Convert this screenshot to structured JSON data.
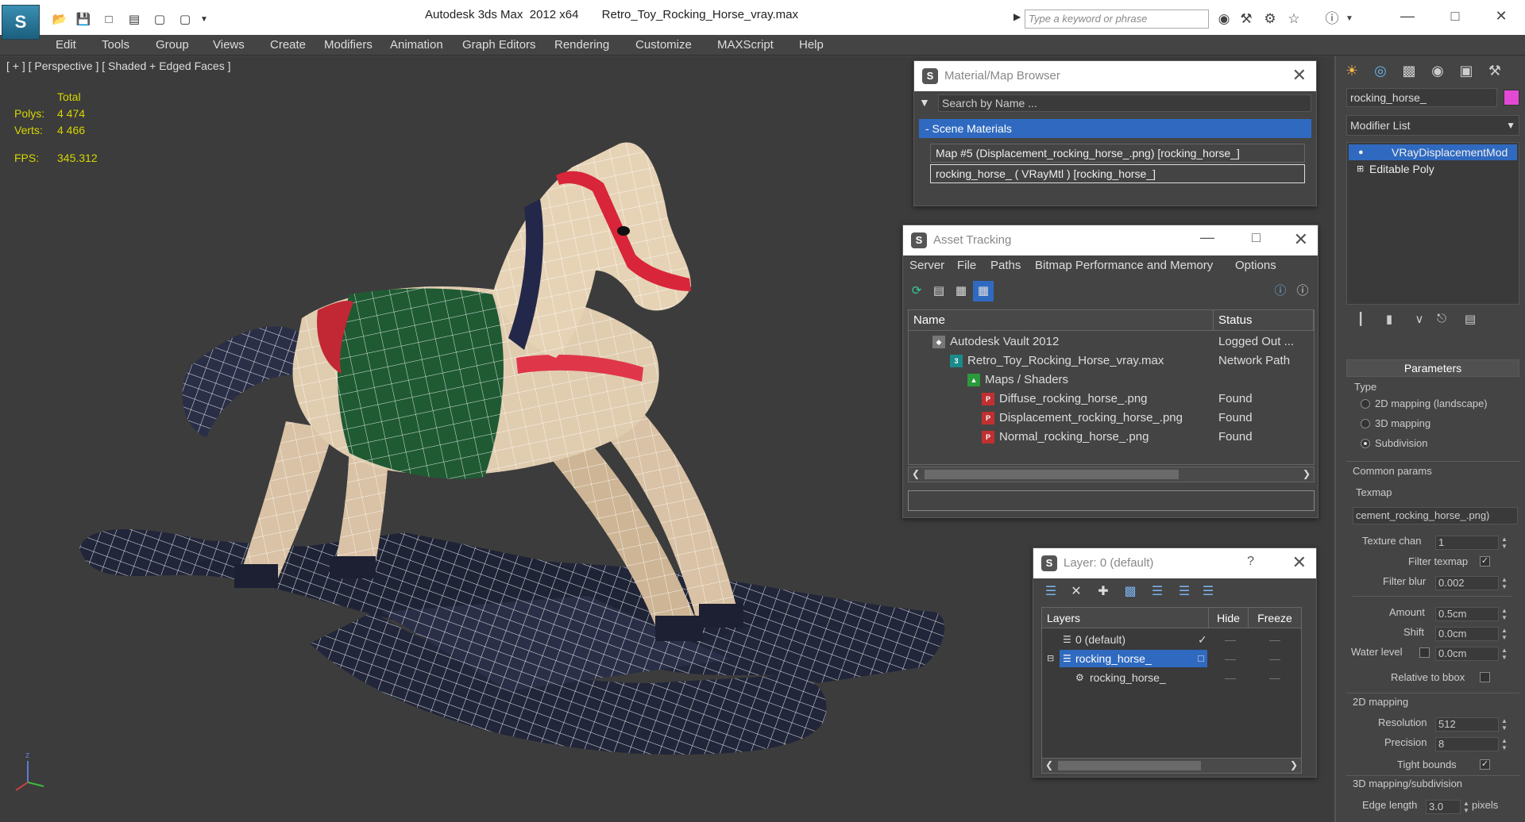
{
  "titlebar": {
    "app_title": "Autodesk 3ds Max  2012 x64",
    "file_name": "Retro_Toy_Rocking_Horse_vray.max",
    "search_placeholder": "Type a keyword or phrase"
  },
  "menu": [
    "Edit",
    "Tools",
    "Group",
    "Views",
    "Create",
    "Modifiers",
    "Animation",
    "Graph Editors",
    "Rendering",
    "Customize",
    "MAXScript",
    "Help"
  ],
  "viewport": {
    "label": "[ + ] [ Perspective ] [ Shaded + Edged Faces ]",
    "stats": {
      "total_label": "Total",
      "polys_label": "Polys:",
      "polys_value": "4 474",
      "verts_label": "Verts:",
      "verts_value": "4 466",
      "fps_label": "FPS:",
      "fps_value": "345.312"
    },
    "axis": {
      "z": "z"
    }
  },
  "material_browser": {
    "title": "Material/Map Browser",
    "search_placeholder": "Search by Name ...",
    "group_label": "- Scene Materials",
    "rows": [
      "Map #5 (Displacement_rocking_horse_.png) [rocking_horse_]",
      "rocking_horse_  ( VRayMtl ) [rocking_horse_]"
    ]
  },
  "asset_tracking": {
    "title": "Asset Tracking",
    "menu": [
      "Server",
      "File",
      "Paths",
      "Bitmap Performance and Memory",
      "Options"
    ],
    "columns": {
      "name": "Name",
      "status": "Status"
    },
    "rows": [
      {
        "name": "Autodesk Vault 2012",
        "status": "Logged Out ...",
        "icon": "vault-icon"
      },
      {
        "name": "Retro_Toy_Rocking_Horse_vray.max",
        "status": "Network Path",
        "icon": "max-file-icon"
      },
      {
        "name": "Maps / Shaders",
        "status": "",
        "icon": "maps-icon"
      },
      {
        "name": "Diffuse_rocking_horse_.png",
        "status": "Found",
        "icon": "png-icon"
      },
      {
        "name": "Displacement_rocking_horse_.png",
        "status": "Found",
        "icon": "png-icon"
      },
      {
        "name": "Normal_rocking_horse_.png",
        "status": "Found",
        "icon": "png-icon"
      }
    ]
  },
  "layer_dialog": {
    "title": "Layer: 0 (default)",
    "help": "?",
    "columns": {
      "layers": "Layers",
      "hide": "Hide",
      "freeze": "Freeze"
    },
    "rows": [
      {
        "name": "0 (default)"
      },
      {
        "name": "rocking_horse_"
      },
      {
        "name": "rocking_horse_"
      }
    ]
  },
  "command_panel": {
    "object_name": "rocking_horse_",
    "object_color": "#e34ad4",
    "modifier_list": "Modifier List",
    "stack": [
      "VRayDisplacementMod",
      "Editable Poly"
    ],
    "parameters": {
      "header": "Parameters",
      "type_label": "Type",
      "type_options": [
        "2D mapping (landscape)",
        "3D mapping",
        "Subdivision"
      ],
      "common_params": "Common params",
      "texmap_label": "Texmap",
      "texmap_value": "cement_rocking_horse_.png)",
      "texture_chan_label": "Texture chan",
      "texture_chan_value": "1",
      "filter_texmap_label": "Filter texmap",
      "filter_blur_label": "Filter blur",
      "filter_blur_value": "0.002",
      "amount_label": "Amount",
      "amount_value": "0.5cm",
      "shift_label": "Shift",
      "shift_value": "0.0cm",
      "water_level_label": "Water level",
      "water_level_value": "0.0cm",
      "relative_bbox_label": "Relative to bbox",
      "mapping2d_label": "2D mapping",
      "resolution_label": "Resolution",
      "resolution_value": "512",
      "precision_label": "Precision",
      "precision_value": "8",
      "tight_bounds_label": "Tight bounds",
      "mapping3d_label": "3D mapping/subdivision",
      "edge_length_label": "Edge length",
      "edge_length_value": "3.0",
      "pixels_label": "pixels"
    }
  },
  "colors": {
    "accent_blue": "#2f6ac0",
    "stats_yellow": "#d6d600",
    "viewport_bg": "#3c3c3c"
  }
}
